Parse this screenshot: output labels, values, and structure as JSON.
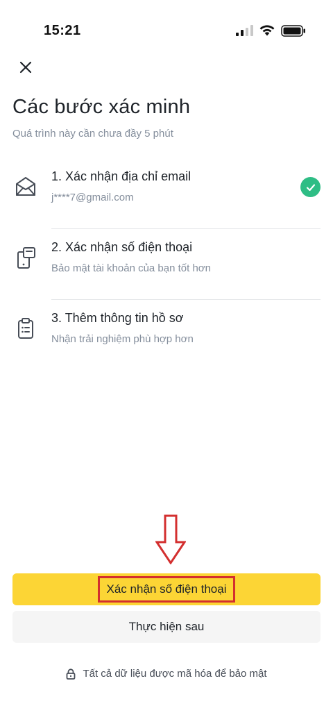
{
  "status_bar": {
    "time": "15:21"
  },
  "icons": {
    "close": "close-icon",
    "email": "envelope-icon",
    "phone": "phone-icon",
    "profile": "clipboard-icon",
    "check": "check-icon",
    "lock": "lock-icon",
    "arrow": "down-arrow-annotation"
  },
  "header": {
    "title": "Các bước xác minh",
    "subtitle": "Quá trình này cần chưa đầy 5 phút"
  },
  "steps": [
    {
      "title": "1. Xác nhận địa chỉ email",
      "description": "j****7@gmail.com",
      "completed": true
    },
    {
      "title": "2. Xác nhận số điện thoại",
      "description": "Bảo mật tài khoản của bạn tốt hơn",
      "completed": false
    },
    {
      "title": "3. Thêm thông tin hồ sơ",
      "description": "Nhận trải nghiệm phù hợp hơn",
      "completed": false
    }
  ],
  "actions": {
    "primary_label": "Xác nhận số điện thoại",
    "secondary_label": "Thực hiện sau"
  },
  "footer": {
    "security_note": "Tất cả dữ liệu được mã hóa để bảo mật"
  },
  "colors": {
    "primary_button": "#fcd535",
    "secondary_button": "#f5f5f5",
    "success": "#2ebd85",
    "annotation": "#d32f2f",
    "muted_text": "#848e9c"
  }
}
